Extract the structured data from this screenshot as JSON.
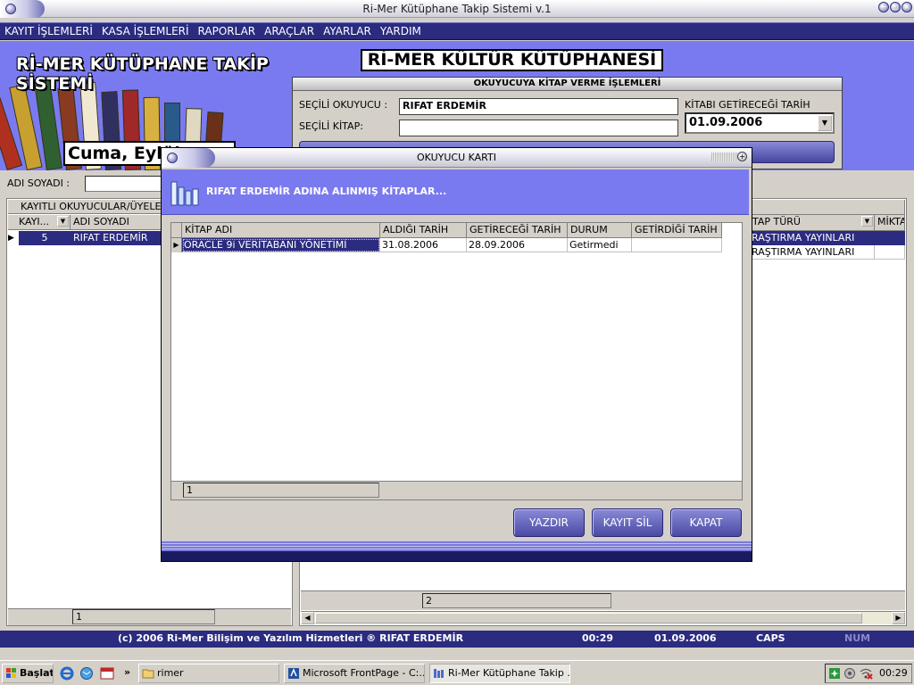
{
  "window": {
    "title": "Ri-Mer Kütüphane Takip Sistemi v.1",
    "buttons": [
      "—",
      "□",
      "×"
    ]
  },
  "menu": [
    "KAYIT İŞLEMLERİ",
    "KASA İŞLEMLERİ",
    "RAPORLAR",
    "ARAÇLAR",
    "AYARLAR",
    "YARDIM"
  ],
  "banner": {
    "app_name": "Rİ-MER KÜTÜPHANE TAKİP SİSTEMİ",
    "date_text": "Cuma, Eylül",
    "library_title": "Rİ-MER KÜLTÜR KÜTÜPHANESİ"
  },
  "loan_panel": {
    "heading": "OKUYUCUYA KİTAP VERME İŞLEMLERİ",
    "reader_label": "SEÇİLİ OKUYUCU :",
    "reader_value": "RIFAT ERDEMİR",
    "book_label": "SEÇİLİ KİTAP:",
    "book_value": "",
    "return_label": "KİTABI GETİRECEĞİ TARİH",
    "return_value": "01.09.2006"
  },
  "search": {
    "label": "ADI SOYADI :",
    "value": ""
  },
  "readers_grid": {
    "caption": "KAYITLI OKUYUCULAR/ÜYELER",
    "columns": [
      "KAYI...",
      "ADI SOYADI"
    ],
    "rows": [
      {
        "id": "5",
        "name": "RIFAT ERDEMİR"
      }
    ],
    "record_position": "1"
  },
  "books_grid": {
    "columns": [
      "TAP TÜRÜ",
      "MİKTA"
    ],
    "rows": [
      {
        "type": "RAŞTIRMA YAYINLARI"
      },
      {
        "type": "RAŞTIRMA YAYINLARI"
      }
    ],
    "record_position": "2"
  },
  "status_bar": {
    "copyright": "(c) 2006 Ri-Mer Bilişim ve Yazılım Hizmetleri ® RIFAT ERDEMİR",
    "time": "00:29",
    "date": "01.09.2006",
    "caps": "CAPS",
    "num": "NUM"
  },
  "dialog": {
    "title": "OKUYUCU KARTI",
    "heading": "RIFAT ERDEMİR ADINA ALINMIŞ KİTAPLAR...",
    "columns": [
      "KİTAP ADI",
      "ALDIĞI TARİH",
      "GETİRECEĞİ TARİH",
      "DURUM",
      "GETİRDİĞİ TARİH"
    ],
    "rows": [
      {
        "title": "ORACLE 9i VERİTABANI YÖNETİMİ",
        "taken": "31.08.2006",
        "due": "28.09.2006",
        "status": "Getirmedi",
        "returned": ""
      }
    ],
    "record_position": "1",
    "buttons": {
      "print": "YAZDIR",
      "delete": "KAYIT SİL",
      "close": "KAPAT"
    }
  },
  "taskbar": {
    "start": "Başlat",
    "overflow": "»",
    "folder": "rimer",
    "items": [
      "Microsoft FrontPage - C:...",
      "Ri-Mer Kütüphane Takip ..."
    ],
    "clock": "00:29"
  },
  "colors": {
    "banner": "#7a7af0",
    "menubar": "#2b2b80",
    "selection": "#2b2b80",
    "button": "#4a4aa4"
  }
}
